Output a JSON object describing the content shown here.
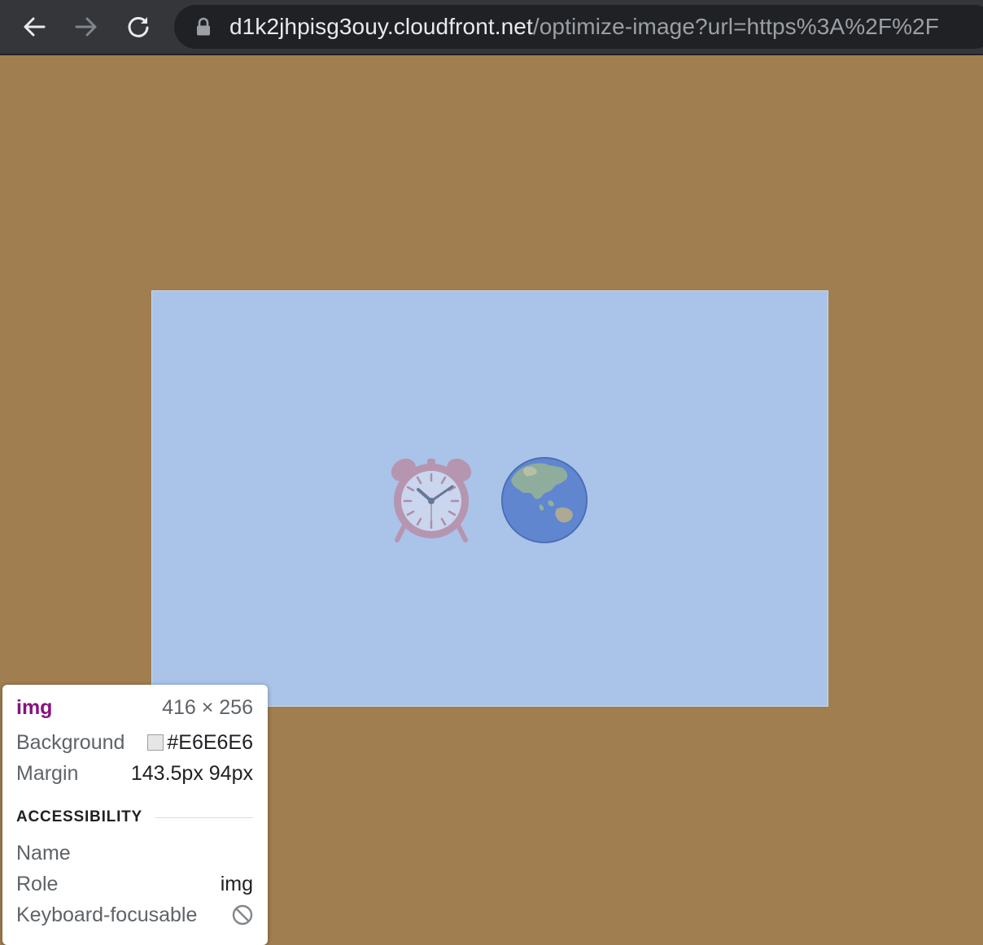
{
  "browser": {
    "url_host": "d1k2jhpisg3ouy.cloudfront.net",
    "url_path": "/optimize-image?url=https%3A%2F%2F",
    "icons": [
      "back-arrow-icon",
      "forward-arrow-icon",
      "reload-icon",
      "lock-icon"
    ]
  },
  "page": {
    "background_color": "#a07e50",
    "image_fill_color": "#aac3e8",
    "emojis": [
      "⏰",
      "🌏"
    ]
  },
  "inspector": {
    "tag": "img",
    "dimensions": "416 × 256",
    "background_label": "Background",
    "background_value": "#E6E6E6",
    "margin_label": "Margin",
    "margin_value": "143.5px 94px",
    "section_title": "ACCESSIBILITY",
    "name_label": "Name",
    "name_value": "",
    "role_label": "Role",
    "role_value": "img",
    "keyboard_label": "Keyboard-focusable",
    "keyboard_icon": "not-allowed-icon"
  }
}
